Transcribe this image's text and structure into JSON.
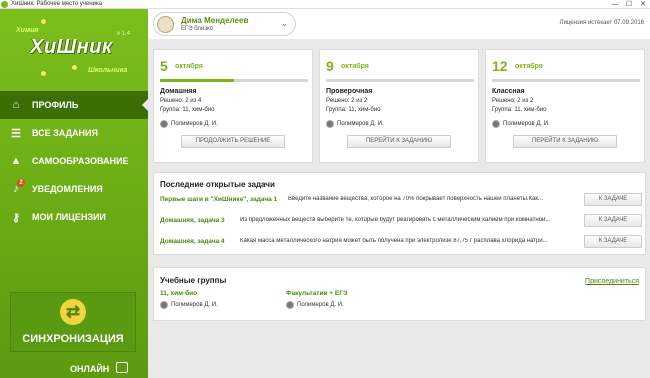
{
  "window": {
    "title": "ХиШник: Рабочее место ученика",
    "minimize": "—",
    "maximize": "☐",
    "close": "✕"
  },
  "logo": {
    "top": "Химия",
    "main": "ХиШник",
    "sub": "Школьника",
    "version": "v 1.4"
  },
  "nav": [
    {
      "label": "ПРОФИЛЬ",
      "icon": "home-icon"
    },
    {
      "label": "ВСЕ ЗАДАНИЯ",
      "icon": "list-icon"
    },
    {
      "label": "САМООБРАЗОВАНИЕ",
      "icon": "graduation-cap-icon"
    },
    {
      "label": "УВЕДОМЛЕНИЯ",
      "icon": "bell-icon",
      "badge": "2"
    },
    {
      "label": "МОИ ЛИЦЕНЗИИ",
      "icon": "key-icon"
    }
  ],
  "sync": {
    "label": "СИНХРОНИЗАЦИЯ"
  },
  "status": {
    "label": "ОНЛАЙН"
  },
  "user": {
    "name": "Дима Менделеев",
    "subtitle": "ЕГЭ близко"
  },
  "license": "Лицензия истекает 07.09.2016",
  "days": [
    {
      "num": "5",
      "month": "октября",
      "progress": 0.5,
      "type": "Домашняя",
      "solved": "Решено: 2 из 4",
      "group": "Группа: 11, хим-био",
      "teacher": "Полимеров Д. И.",
      "button": "ПРОДОЛЖИТЬ РЕШЕНИЕ"
    },
    {
      "num": "9",
      "month": "октября",
      "progress": 0,
      "type": "Проверочная",
      "solved": "Решено: 2 из 2",
      "group": "Группа: 11, хим-био",
      "teacher": "Полимеров Д. И.",
      "button": "ПЕРЕЙТИ К ЗАДАНИЮ"
    },
    {
      "num": "12",
      "month": "октября",
      "progress": 0,
      "type": "Классная",
      "solved": "Решено: 2 из 2",
      "group": "Группа: 11, хим-био",
      "teacher": "Полимеров Д. И.",
      "button": "ПЕРЕЙТИ К ЗАДАНИЮ"
    }
  ],
  "recent": {
    "title": "Последние открытые задачи",
    "tasks": [
      {
        "name": "Первые шаги в \"ХиШнике\", задача 1",
        "desc": "Введите название вещества, которое на 70% покрывает поверхность нашей планеты.Как...",
        "button": "К ЗАДАЧЕ"
      },
      {
        "name": "Домашняя, задача 3",
        "desc": "Из предложенных веществ выберите те, которые будут реагировать с металлическим калием при комнатной...",
        "button": "К ЗАДАЧЕ"
      },
      {
        "name": "Домашняя, задача 4",
        "desc": "Какая масса металлического натрия может быть получена при электролизе 87,75 г расплава хлорида натри...",
        "button": "К ЗАДАЧЕ"
      }
    ]
  },
  "groups": {
    "title": "Учебные группы",
    "join": "Присоединиться",
    "items": [
      {
        "name": "11, хим-био",
        "teacher": "Полимеров Д. И."
      },
      {
        "name": "Факультатив + ЕГЭ",
        "teacher": "Полимеров Д. И."
      }
    ]
  }
}
